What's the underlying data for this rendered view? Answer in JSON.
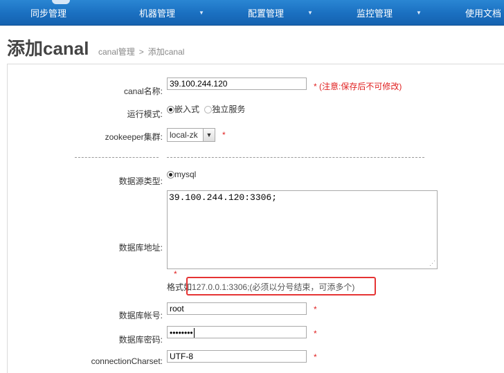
{
  "nav": {
    "items": [
      "同步管理",
      "机器管理",
      "配置管理",
      "监控管理",
      "使用文档"
    ]
  },
  "page": {
    "title": "添加canal"
  },
  "breadcrumb": {
    "parent": "canal管理",
    "separator": ">",
    "current": "添加canal"
  },
  "form": {
    "name_label": "canal名称:",
    "name_value": "39.100.244.120",
    "name_note": "* (注意:保存后不可修改)",
    "mode_label": "运行模式:",
    "mode_embedded": "嵌入式",
    "mode_standalone": "独立服务",
    "zk_label": "zookeeper集群:",
    "zk_value": "local-zk",
    "zk_required": "*",
    "ds_type_label": "数据源类型:",
    "ds_type_value": "mysql",
    "db_addr_label": "数据库地址:",
    "db_addr_value": "39.100.244.120:3306;",
    "db_addr_required": "*",
    "format_prefix": "格式如",
    "format_example": "127.0.0.1:3306;(必须以分号结束，可添多个)",
    "db_user_label": "数据库帐号:",
    "db_user_value": "root",
    "db_user_required": "*",
    "db_pass_label": "数据库密码:",
    "db_pass_value": "••••••••",
    "db_pass_required": "*",
    "charset_label": "connectionCharset:",
    "charset_value": "UTF-8",
    "charset_required": "*"
  },
  "colors": {
    "nav_bg": "#1a6fc0",
    "required": "#e02020",
    "highlight_box": "#e53333"
  }
}
